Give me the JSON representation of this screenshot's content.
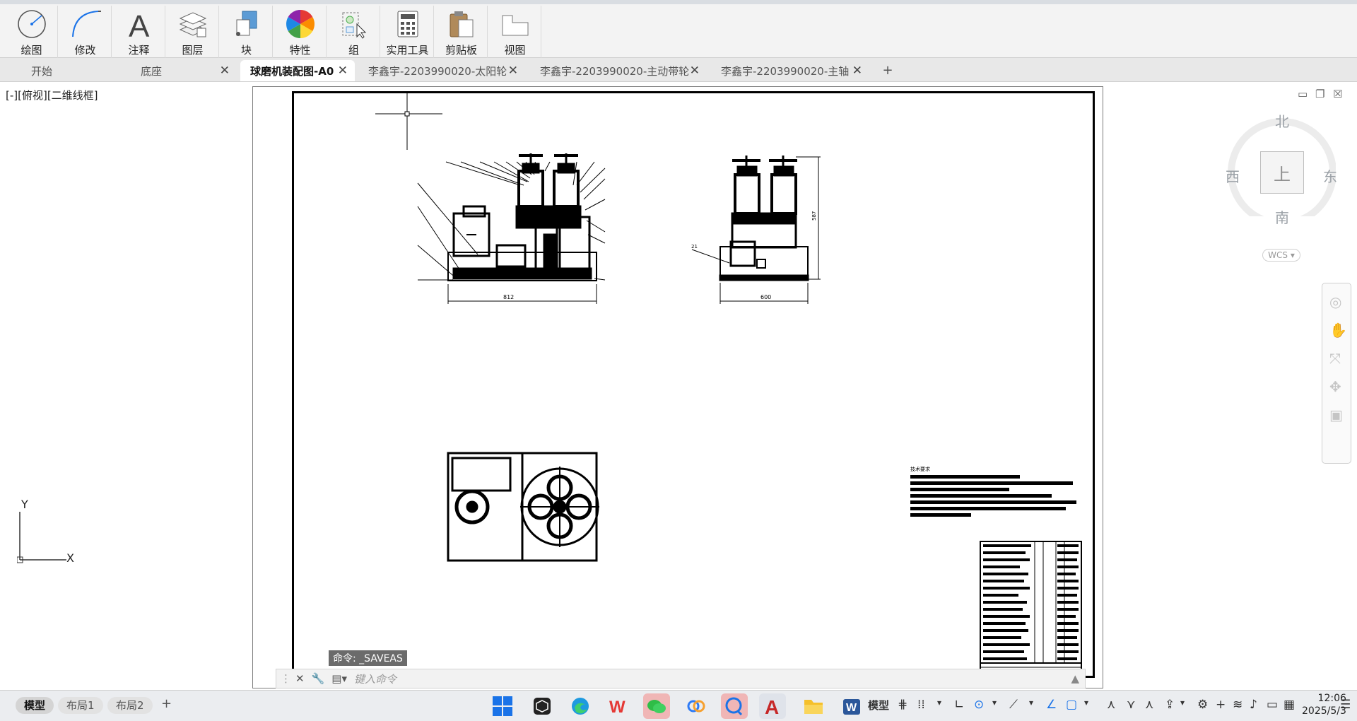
{
  "ribbon": {
    "groups": [
      {
        "label": "绘图",
        "icon": "circle-draw-icon"
      },
      {
        "label": "修改",
        "icon": "arc-modify-icon"
      },
      {
        "label": "注释",
        "icon": "text-annotation-icon"
      },
      {
        "label": "图层",
        "icon": "layers-icon"
      },
      {
        "label": "块",
        "icon": "block-icon"
      },
      {
        "label": "特性",
        "icon": "color-wheel-icon"
      },
      {
        "label": "组",
        "icon": "group-icon"
      },
      {
        "label": "实用工具",
        "icon": "calculator-icon"
      },
      {
        "label": "剪贴板",
        "icon": "clipboard-icon"
      },
      {
        "label": "视图",
        "icon": "view-icon"
      }
    ]
  },
  "tabs": [
    {
      "label": "开始"
    },
    {
      "label": "底座"
    },
    {
      "label": "球磨机装配图-A0"
    },
    {
      "label": "李鑫宇-2203990020-太阳轮"
    },
    {
      "label": "李鑫宇-2203990020-主动带轮"
    },
    {
      "label": "李鑫宇-2203990020-主轴"
    }
  ],
  "viewport": {
    "label": "[-][俯视][二维线框]"
  },
  "viewcube": {
    "north": "北",
    "south": "南",
    "east": "东",
    "west": "西",
    "top": "上",
    "wcs": "WCS"
  },
  "drawing": {
    "dim_front_width": "812",
    "dim_side_width": "600",
    "dim_side_height": "587",
    "tech_title": "技术要求",
    "part_label": "21"
  },
  "command": {
    "last_message": "命令: _SAVEAS",
    "input_placeholder": "键入命令"
  },
  "ucs": {
    "x": "X",
    "y": "Y"
  },
  "layout_tabs": [
    {
      "label": "模型"
    },
    {
      "label": "布局1"
    },
    {
      "label": "布局2"
    }
  ],
  "status": {
    "model": "模型"
  },
  "clock": {
    "time": "12:06",
    "date": "2025/5/3"
  }
}
